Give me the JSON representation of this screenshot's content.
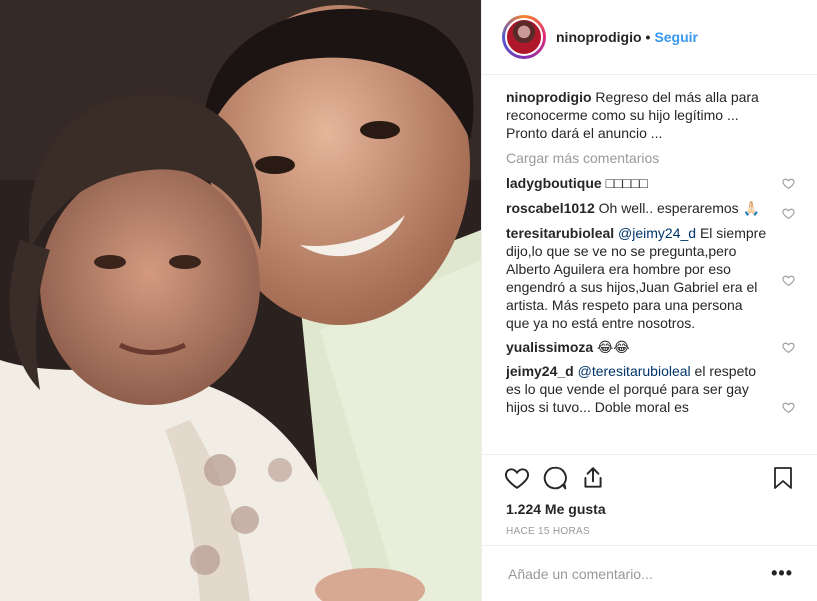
{
  "header": {
    "username": "ninoprodigio",
    "separator": "•",
    "follow_label": "Seguir"
  },
  "caption": {
    "username": "ninoprodigio",
    "text": "Regreso del más alla para reconocerme como su hijo legítimo ... Pronto dará el anuncio ..."
  },
  "load_more_label": "Cargar más comentarios",
  "comments": [
    {
      "username": "ladygboutique",
      "text": "□□□□□"
    },
    {
      "username": "roscabel1012",
      "text": "Oh well.. esperaremos 🙏🏻"
    },
    {
      "username": "teresitarubioleal",
      "mention": "@jeimy24_d",
      "text": "El siempre dijo,lo que se ve no se pregunta,pero Alberto Aguilera era hombre por eso engendró a sus hijos,Juan Gabriel era el artista. Más respeto para una persona que ya no está entre nosotros."
    },
    {
      "username": "yualissimoza",
      "text": "😂😂"
    },
    {
      "username": "jeimy24_d",
      "mention": "@teresitarubioleal",
      "text": "el respeto es lo que vende el porqué para ser gay hijos si tuvo... Doble moral es"
    }
  ],
  "likes_label": "1.224 Me gusta",
  "time_label": "HACE 15 HORAS",
  "add_comment_placeholder": "Añade un comentario...",
  "more_options": "•••",
  "icons": {
    "like": "heart-icon",
    "comment": "comment-bubble-icon",
    "share": "share-icon",
    "save": "bookmark-icon",
    "options": "ellipsis-icon"
  },
  "colors": {
    "link": "#3897f0",
    "mention": "#003569",
    "muted": "#999999",
    "border": "#efefef"
  }
}
